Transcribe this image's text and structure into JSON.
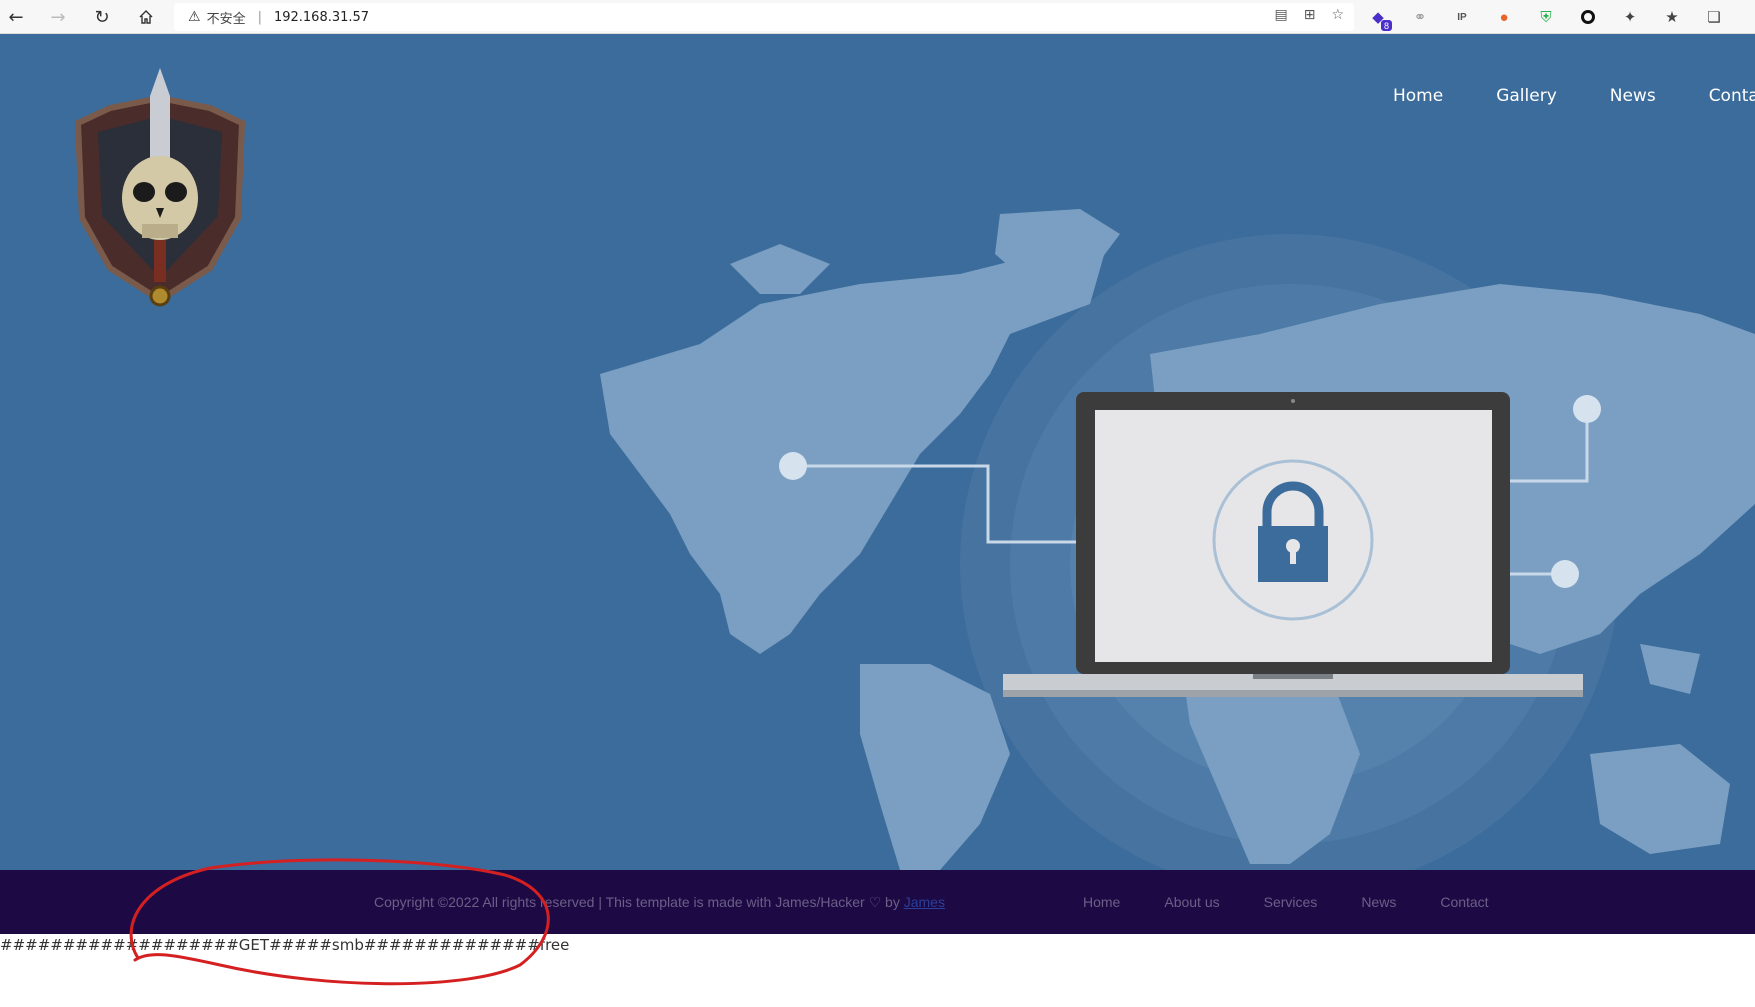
{
  "browser": {
    "security_label": "不安全",
    "url": "192.168.31.57",
    "extensions": [
      {
        "icon": "extension-purple-icon",
        "badge": "8"
      },
      {
        "icon": "extension-link-icon"
      },
      {
        "icon": "extension-ip-icon"
      },
      {
        "icon": "extension-orange-icon"
      },
      {
        "icon": "extension-shield-icon"
      },
      {
        "icon": "extension-circle-icon"
      },
      {
        "icon": "puzzle-icon"
      },
      {
        "icon": "favorites-icon"
      },
      {
        "icon": "collections-icon"
      }
    ]
  },
  "site": {
    "nav": [
      "Home",
      "Gallery",
      "News",
      "Contact"
    ]
  },
  "footer": {
    "copyright": "Copyright ©2022 All rights reserved | This template is made with James/Hacker",
    "by": "by",
    "author": "James",
    "nav": [
      "Home",
      "About us",
      "Services",
      "News",
      "Contact"
    ]
  },
  "raw_text": "###################GET#####smb##############free",
  "colors": {
    "hero_bg": "#3b6c9b",
    "footer_bg": "#1d0a45",
    "annotation": "#d42020"
  }
}
